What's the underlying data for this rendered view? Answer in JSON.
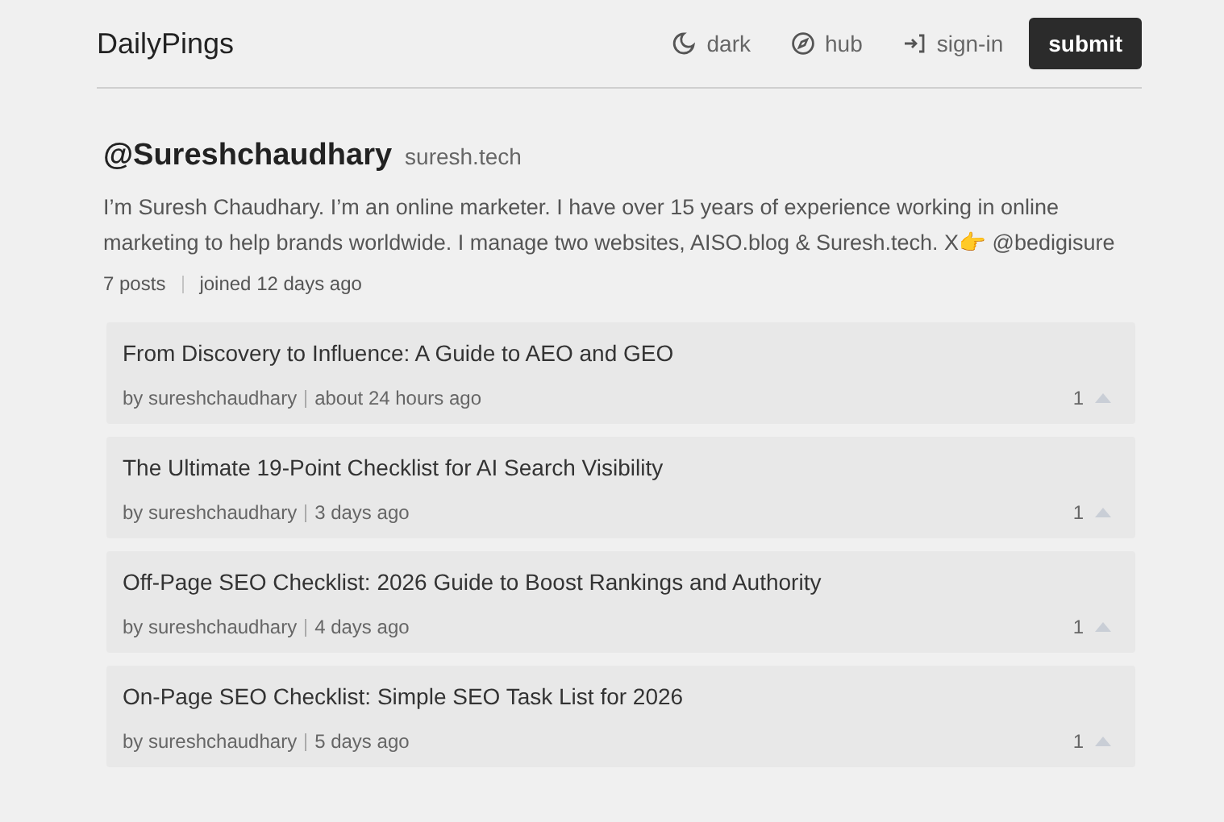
{
  "header": {
    "logo": "DailyPings",
    "nav": [
      {
        "kind": "moon",
        "label": "dark"
      },
      {
        "kind": "compass",
        "label": "hub"
      },
      {
        "kind": "signin",
        "label": "sign-in"
      }
    ],
    "submit": "submit"
  },
  "profile": {
    "handle": "@Sureshchaudhary",
    "site": "suresh.tech",
    "bio": "I’m Suresh Chaudhary. I’m an online marketer. I have over 15 years of experience working in online marketing to help brands worldwide. I manage two websites, AISO.blog & Suresh.tech. X👉 @bedigisure",
    "posts": "7 posts",
    "joined": "joined 12 days ago"
  },
  "posts": [
    {
      "title": "From Discovery to Influence: A Guide to AEO and GEO",
      "author": "by sureshchaudhary",
      "time": "about 24 hours ago",
      "votes": "1"
    },
    {
      "title": "The Ultimate 19-Point Checklist for AI Search Visibility",
      "author": "by sureshchaudhary",
      "time": "3 days ago",
      "votes": "1"
    },
    {
      "title": "Off-Page SEO Checklist: 2026 Guide to Boost Rankings and Authority",
      "author": "by sureshchaudhary",
      "time": "4 days ago",
      "votes": "1"
    },
    {
      "title": "On-Page SEO Checklist: Simple SEO Task List for 2026",
      "author": "by sureshchaudhary",
      "time": "5 days ago",
      "votes": "1"
    }
  ]
}
